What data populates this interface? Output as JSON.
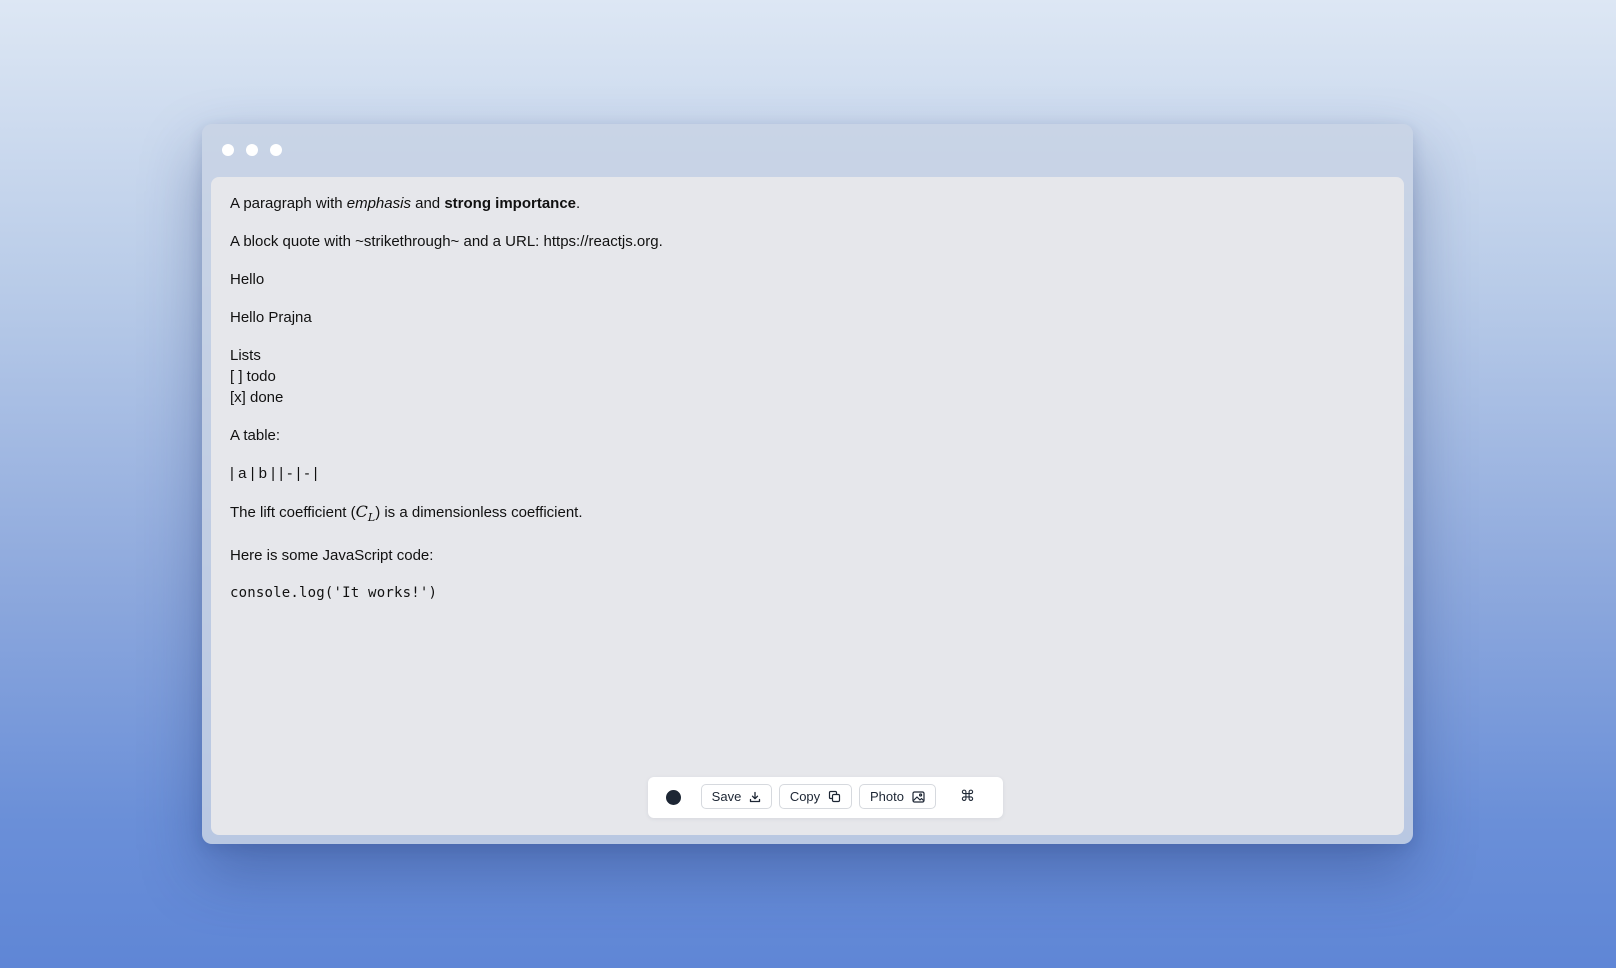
{
  "colors": {
    "window_frame": "#c8d2e4",
    "content_background": "#e6e7eb",
    "toolbar_background": "#ffffff",
    "toolbar_dot": "#1d2634"
  },
  "window": {
    "controls": [
      "close-dot",
      "minimize-dot",
      "maximize-dot"
    ]
  },
  "document": {
    "para1": {
      "prefix": "A paragraph with ",
      "emphasis": "emphasis",
      "middle": " and ",
      "strong": "strong importance",
      "suffix": "."
    },
    "para2": "A block quote with ~strikethrough~ and a URL: https://reactjs.org.",
    "para3": "Hello",
    "para4": "Hello Prajna",
    "lists": {
      "title": "Lists",
      "items": [
        "[ ] todo",
        "[x] done"
      ]
    },
    "table_intro": "A table:",
    "table_raw": "| a | b | | - | - |",
    "lift": {
      "prefix": "The lift coefficient (",
      "math_main": "C",
      "math_sub": "L",
      "suffix": ") is a dimensionless coefficient."
    },
    "code_intro": "Here is some JavaScript code:",
    "code": "console.log('It works!')"
  },
  "toolbar": {
    "color_icon": "filled-circle-icon",
    "save_label": "Save",
    "save_icon": "download-icon",
    "copy_label": "Copy",
    "copy_icon": "copy-icon",
    "photo_label": "Photo",
    "photo_icon": "image-icon",
    "command_symbol": "⌘"
  }
}
